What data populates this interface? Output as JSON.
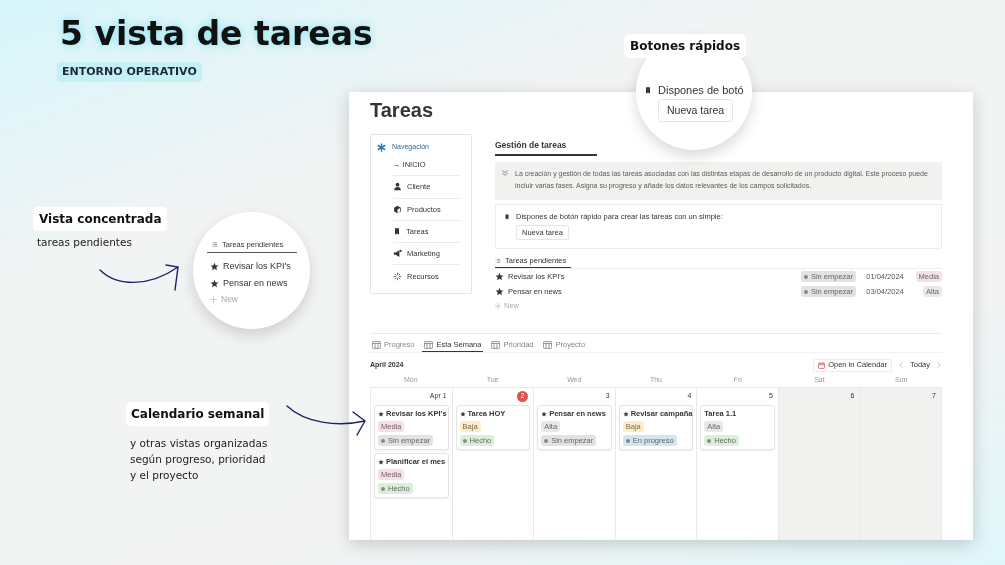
{
  "slide": {
    "title": "5 vista de tareas",
    "subtitle": "ENTORNO OPERATIVO"
  },
  "callout_buttons": {
    "title": "Botones rápidos",
    "text": "Dispones de botó",
    "button": "Nueva tarea"
  },
  "callout_focus": {
    "title": "Vista concentrada",
    "text": "tareas pendientes",
    "list_title": "Tareas pendientes",
    "items": [
      "Revisar los KPI's",
      "Pensar en news"
    ],
    "new_label": "New"
  },
  "callout_calendar": {
    "title": "Calendario semanal",
    "lines": [
      "y otras vistas organizadas",
      "según progreso, prioridad",
      "y el proyecto"
    ]
  },
  "page": {
    "title": "Tareas",
    "nav": {
      "title": "Navegación",
      "items": [
        "→ INICIO",
        "Cliente",
        "Productos",
        "Tareas",
        "Marketing",
        "Recursos"
      ]
    },
    "section_tab": "Gestión de tareas",
    "description": "La creación y gestión de todas las tareas asociadas con las distintas etapas de desarrollo de un producto digital. Este proceso puede incluir varias fases. Asigna su progreso y añade los datos relevantes de los campos solicitados.",
    "quick": {
      "text": "Dispones de botón rápido para crear las tareas con un simple:",
      "button": "Nueva tarea"
    },
    "pending": {
      "title": "Tareas pendientes",
      "new_label": "New",
      "rows": [
        {
          "name": "Revisar los KPI's",
          "status": {
            "label": "Sin empezar",
            "color": "#e3e2e0"
          },
          "date": "01/04/2024",
          "priority": {
            "label": "Media",
            "color": "#f5e0e9"
          }
        },
        {
          "name": "Pensar en news",
          "status": {
            "label": "Sin empezar",
            "color": "#e3e2e0"
          },
          "date": "03/04/2024",
          "priority": {
            "label": "Alta",
            "color": "#e9e8e6"
          }
        }
      ]
    },
    "views": [
      {
        "label": "Progreso",
        "selected": false
      },
      {
        "label": "Esta Semana",
        "selected": true
      },
      {
        "label": "Prioridad",
        "selected": false
      },
      {
        "label": "Proyecto",
        "selected": false
      }
    ],
    "calendar": {
      "month": "April 2024",
      "open_button": "Open in Calendar",
      "today_button": "Today",
      "weekdays": [
        "Mon",
        "Tue",
        "Wed",
        "Thu",
        "Fri",
        "Sat",
        "Sun"
      ],
      "days": [
        {
          "label": "Apr 1",
          "today": false,
          "weekend": false,
          "events": [
            {
              "title": "Revisar los KPI's",
              "starred": true,
              "priority": {
                "label": "Media",
                "color": "#f5e0e9"
              },
              "status": {
                "label": "Sin empezar",
                "color": "#e3e2e0"
              }
            },
            {
              "title": "Planificar el mes",
              "starred": true,
              "priority": {
                "label": "Media",
                "color": "#f5e0e9"
              },
              "status": {
                "label": "Hecho",
                "color": "#dbeddb"
              }
            }
          ]
        },
        {
          "label": "2",
          "today": true,
          "weekend": false,
          "events": [
            {
              "title": "Tarea HOY",
              "starred": true,
              "priority": {
                "label": "Baja",
                "color": "#fdecc8"
              },
              "status": {
                "label": "Hecho",
                "color": "#dbeddb"
              }
            }
          ]
        },
        {
          "label": "3",
          "today": false,
          "weekend": false,
          "events": [
            {
              "title": "Pensar en news",
              "starred": true,
              "priority": {
                "label": "Alta",
                "color": "#e9e8e6"
              },
              "status": {
                "label": "Sin empezar",
                "color": "#e3e2e0"
              }
            }
          ]
        },
        {
          "label": "4",
          "today": false,
          "weekend": false,
          "events": [
            {
              "title": "Revisar campaña",
              "starred": true,
              "priority": {
                "label": "Baja",
                "color": "#fdecc8"
              },
              "status": {
                "label": "En progreso",
                "color": "#d3e5ef"
              }
            }
          ]
        },
        {
          "label": "5",
          "today": false,
          "weekend": false,
          "events": [
            {
              "title": "Tarea 1.1",
              "starred": false,
              "priority": {
                "label": "Alta",
                "color": "#e9e8e6"
              },
              "status": {
                "label": "Hecho",
                "color": "#dbeddb"
              }
            }
          ]
        },
        {
          "label": "6",
          "today": false,
          "weekend": true
        },
        {
          "label": "7",
          "today": false,
          "weekend": true
        }
      ]
    }
  }
}
